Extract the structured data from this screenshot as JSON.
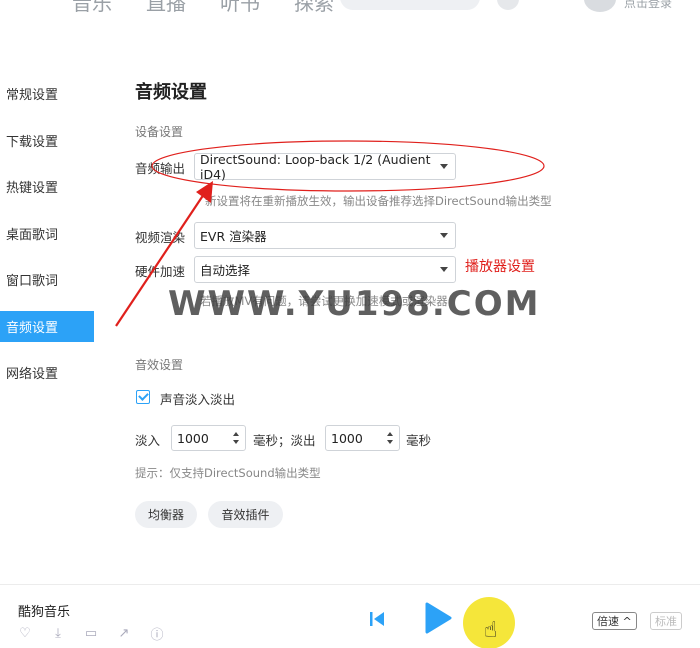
{
  "top_nav": {
    "items": [
      "音乐",
      "直播",
      "听书",
      "探索"
    ],
    "login": "点击登录"
  },
  "sidebar": {
    "items": [
      {
        "label": "常规设置"
      },
      {
        "label": "下载设置"
      },
      {
        "label": "热键设置"
      },
      {
        "label": "桌面歌词"
      },
      {
        "label": "窗口歌词"
      },
      {
        "label": "音频设置",
        "active": true
      },
      {
        "label": "网络设置"
      }
    ]
  },
  "main": {
    "title": "音频设置",
    "device_section": "设备设置",
    "audio_output": {
      "label": "音频输出",
      "value": "DirectSound: Loop-back 1/2 (Audient iD4)"
    },
    "output_hint": "新设置将在重新播放生效，输出设备推荐选择DirectSound输出类型",
    "video_render": {
      "label": "视频渲染",
      "value": "EVR 渲染器"
    },
    "hw_accel": {
      "label": "硬件加速",
      "value": "自动选择"
    },
    "hw_hint": "若播放MV有问题，请尝试更换加速模式或渲染器",
    "effects_section": "音效设置",
    "fade_checkbox": {
      "label": "声音淡入淡出",
      "checked": true
    },
    "fade_in_label": "淡入",
    "fade_in_value": "1000",
    "fade_out_label": "毫秒；淡出",
    "fade_out_value": "1000",
    "ms_label": "毫秒",
    "tip": "提示：仅支持DirectSound输出类型",
    "equalizer_button": "均衡器",
    "plugin_button": "音效插件"
  },
  "annotation": {
    "label": "播放器设置",
    "color": "#e0201c"
  },
  "watermark": "WWW.YU198.COM",
  "player": {
    "title": "酷狗音乐",
    "speed_button": "倍速",
    "quality_button": "标准"
  },
  "colors": {
    "accent": "#2ca2f7",
    "highlight": "#f5e63a"
  }
}
